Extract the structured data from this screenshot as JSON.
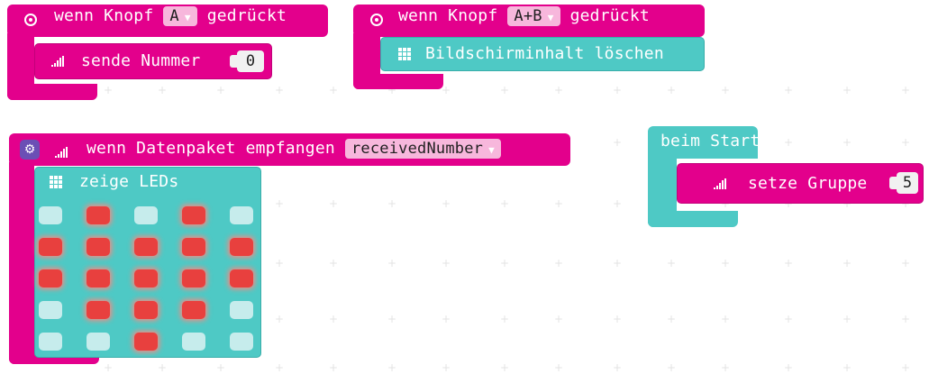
{
  "blocks": {
    "button_a": {
      "prefix": "wenn Knopf",
      "dropdown": "A",
      "suffix": "gedrückt",
      "inner_label": "sende Nummer",
      "inner_value": "0"
    },
    "button_ab": {
      "prefix": "wenn Knopf",
      "dropdown": "A+B",
      "suffix": "gedrückt",
      "inner_label": "Bildschirminhalt löschen"
    },
    "radio_received": {
      "prefix": "wenn Datenpaket empfangen",
      "dropdown": "receivedNumber",
      "inner_label": "zeige LEDs",
      "led_rows": [
        [
          0,
          1,
          0,
          1,
          0
        ],
        [
          1,
          1,
          1,
          1,
          1
        ],
        [
          1,
          1,
          1,
          1,
          1
        ],
        [
          0,
          1,
          1,
          1,
          0
        ],
        [
          0,
          0,
          1,
          0,
          0
        ]
      ]
    },
    "on_start": {
      "label": "beim Start",
      "inner_label": "setze Gruppe",
      "inner_value": "5"
    }
  },
  "icons": {
    "radio_button_icon": "radio-icon",
    "signal": "signal-icon",
    "led_grid": "grid-icon",
    "gear": "gear-icon",
    "caret": "caret-down-icon"
  },
  "colors": {
    "pink": "#e3008c",
    "teal": "#4ec9c5",
    "led_on": "#e8403e",
    "led_off": "#c6ecec",
    "dropdown_bg": "#f7b7dc"
  }
}
